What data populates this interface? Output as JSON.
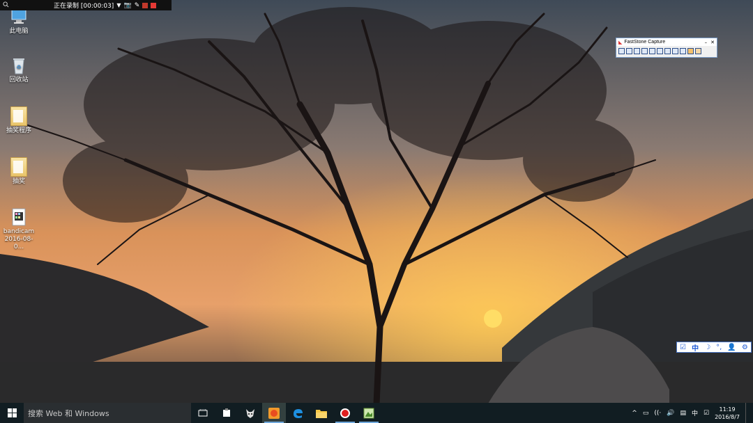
{
  "desktop_icons": [
    {
      "name": "this-pc",
      "label": "此电脑"
    },
    {
      "name": "recycle-bin",
      "label": "回收站"
    },
    {
      "name": "folder-lottery-program",
      "label": "抽奖程序"
    },
    {
      "name": "folder-lottery",
      "label": "抽奖"
    },
    {
      "name": "bandicam-video",
      "label": "bandicam 2016-08-0..."
    }
  ],
  "recorder": {
    "status": "正在录制 [00:00:03]"
  },
  "faststone": {
    "title": "FastStone Capture"
  },
  "ime_bar": {
    "lang": "中"
  },
  "taskbar": {
    "search_placeholder": "搜索 Web 和 Windows",
    "time": "11:19",
    "date": "2016/8/7",
    "lang": "中"
  }
}
